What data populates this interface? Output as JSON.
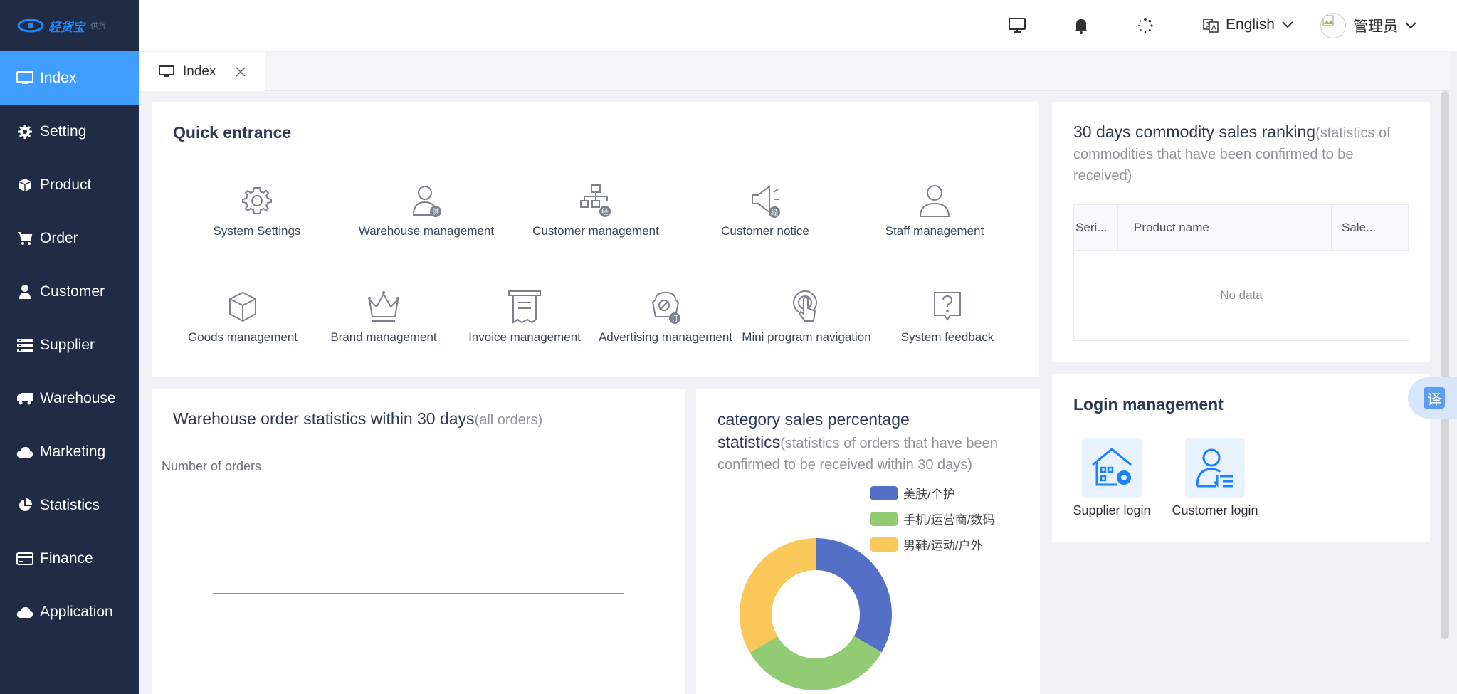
{
  "brand": {
    "logo_text": "轻货宝",
    "logo_sub": "供货"
  },
  "sidebar": {
    "items": [
      {
        "label": "Index",
        "icon": "monitor-icon"
      },
      {
        "label": "Setting",
        "icon": "gear-icon"
      },
      {
        "label": "Product",
        "icon": "box-icon"
      },
      {
        "label": "Order",
        "icon": "cart-icon"
      },
      {
        "label": "Customer",
        "icon": "person-icon"
      },
      {
        "label": "Supplier",
        "icon": "list-icon"
      },
      {
        "label": "Warehouse",
        "icon": "truck-icon"
      },
      {
        "label": "Marketing",
        "icon": "cloud-icon"
      },
      {
        "label": "Statistics",
        "icon": "pie-icon"
      },
      {
        "label": "Finance",
        "icon": "card-icon"
      },
      {
        "label": "Application",
        "icon": "cloud-icon"
      }
    ]
  },
  "header": {
    "language": "English",
    "username": "管理员"
  },
  "tabs": [
    {
      "label": "Index"
    }
  ],
  "quick_entrance": {
    "title": "Quick entrance",
    "row1": [
      {
        "label": "System Settings",
        "icon": "gear-icon"
      },
      {
        "label": "Warehouse management",
        "icon": "person-badge-icon",
        "badge": "供"
      },
      {
        "label": "Customer management",
        "icon": "org-chart-icon",
        "badge": "经"
      },
      {
        "label": "Customer notice",
        "icon": "megaphone-icon",
        "badge": "经"
      },
      {
        "label": "Staff management",
        "icon": "person-icon"
      }
    ],
    "row2": [
      {
        "label": "Goods management",
        "icon": "cube-icon"
      },
      {
        "label": "Brand management",
        "icon": "crown-icon"
      },
      {
        "label": "Invoice management",
        "icon": "receipt-icon"
      },
      {
        "label": "Advertising management",
        "icon": "ad-icon",
        "badge": "订"
      },
      {
        "label": "Mini program navigation",
        "icon": "tap-icon"
      },
      {
        "label": "System feedback",
        "icon": "question-bubble-icon"
      }
    ]
  },
  "ranking": {
    "title": "30 days commodity sales ranking",
    "subtitle": "(statistics of commodities that have been confirmed to be received)",
    "columns": [
      "Seri...",
      "Product name",
      "Sale..."
    ],
    "empty_text": "No data"
  },
  "login_management": {
    "title": "Login management",
    "tiles": [
      {
        "label": "Supplier login",
        "icon": "house-gear-icon"
      },
      {
        "label": "Customer login",
        "icon": "person-list-icon"
      }
    ]
  },
  "warehouse_stats": {
    "title": "Warehouse order statistics within 30 days",
    "subtitle": "(all orders)",
    "ylabel": "Number of orders"
  },
  "category_stats": {
    "title": "category sales percentage statistics",
    "subtitle": "(statistics of orders that have been confirmed to be received within 30 days)"
  },
  "chart_data": [
    {
      "type": "line",
      "title": "Warehouse order statistics within 30 days",
      "ylabel": "Number of orders",
      "series": []
    },
    {
      "type": "pie",
      "title": "category sales percentage statistics",
      "categories": [
        "美肤/个护",
        "手机/运营商/数码",
        "男鞋/运动/户外"
      ],
      "values": [
        33.3,
        33.3,
        33.4
      ],
      "colors": [
        "#5470c6",
        "#91cc75",
        "#fac858"
      ],
      "legend": "top-right"
    }
  ],
  "translate": {
    "label": "译"
  }
}
